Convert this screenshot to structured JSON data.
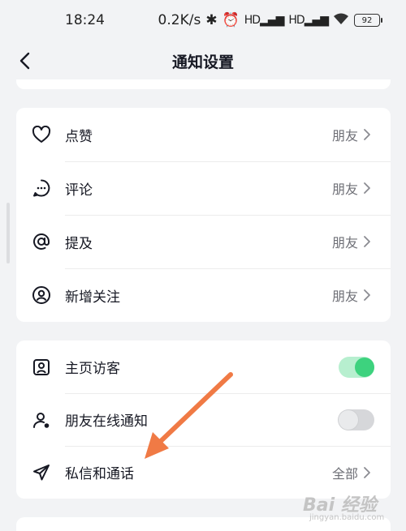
{
  "status": {
    "time": "18:24",
    "speed": "0.2K/s",
    "signal1": "HD",
    "signal2": "HD",
    "battery": "92"
  },
  "header": {
    "title": "通知设置"
  },
  "section1": {
    "items": [
      {
        "label": "点赞",
        "value": "朋友"
      },
      {
        "label": "评论",
        "value": "朋友"
      },
      {
        "label": "提及",
        "value": "朋友"
      },
      {
        "label": "新增关注",
        "value": "朋友"
      }
    ]
  },
  "section2": {
    "items": [
      {
        "label": "主页访客",
        "toggle": "on"
      },
      {
        "label": "朋友在线通知",
        "toggle": "off"
      },
      {
        "label": "私信和通话",
        "value": "全部"
      }
    ]
  },
  "watermark": {
    "main": "Bai 经验",
    "sub": "jingyan.baidu.com"
  },
  "colors": {
    "toggle_on": "#3dd27e",
    "toggle_on_track": "#b7efcf",
    "arrow": "#f07a45",
    "background": "#f2f3f5"
  },
  "icons": [
    "chevron-left-icon",
    "heart-icon",
    "comment-icon",
    "at-icon",
    "user-circle-icon",
    "profile-visitor-icon",
    "user-online-icon",
    "paper-plane-icon",
    "chevron-right-icon"
  ]
}
